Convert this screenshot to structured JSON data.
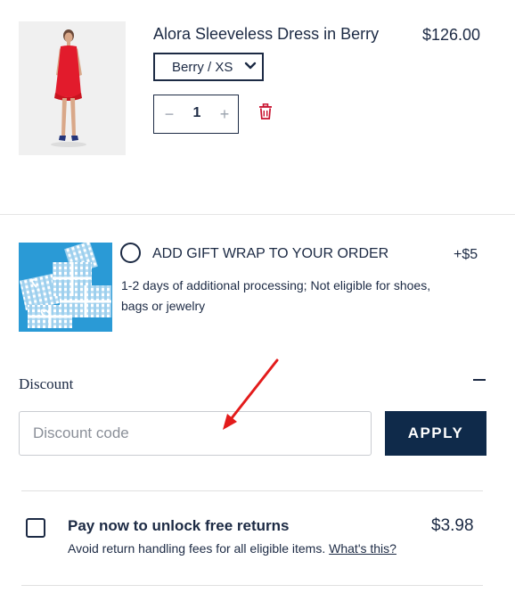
{
  "product": {
    "title": "Alora Sleeveless Dress in Berry",
    "price": "$126.00",
    "variant": "Berry / XS",
    "quantity": "1",
    "quantity_minus": "−",
    "quantity_plus": "+",
    "image_icon": "dress-photo",
    "delete_icon": "trash-icon"
  },
  "gift_wrap": {
    "title": "ADD GIFT WRAP TO YOUR ORDER",
    "price": "+$5",
    "note": "1-2 days of additional processing; Not eligible for shoes, bags or jewelry",
    "image_icon": "gift-boxes-photo",
    "selected": false
  },
  "discount": {
    "label": "Discount",
    "placeholder": "Discount code",
    "value": "",
    "apply_label": "APPLY",
    "collapse_icon": "minus-icon"
  },
  "returns": {
    "title": "Pay now to unlock free returns",
    "price": "$3.98",
    "note": "Avoid return handling fees for all eligible items.",
    "link": "What's this?",
    "checked": false
  },
  "colors": {
    "navy": "#1c2a44",
    "apply_button": "#0f2a4a",
    "delete_red": "#c8102e",
    "annotation_red": "#e31b1b",
    "dress_red": "#e21b2c",
    "gift_blue": "#2a9ad6"
  }
}
